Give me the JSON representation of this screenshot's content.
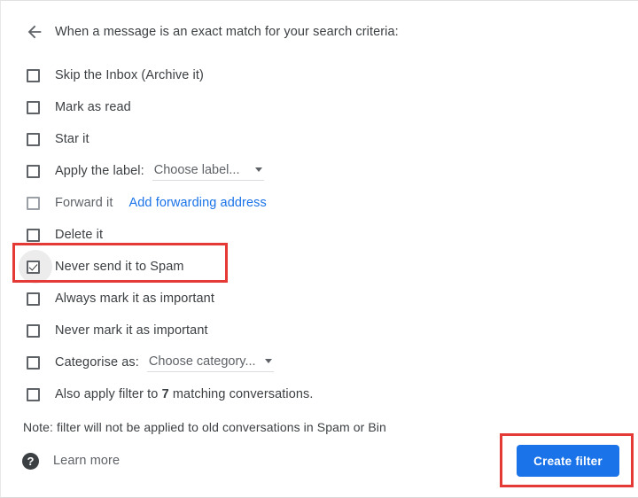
{
  "header": {
    "back_icon": "arrow-left-icon",
    "title": "When a message is an exact match for your search criteria:"
  },
  "options": [
    {
      "label": "Skip the Inbox (Archive it)",
      "checked": false,
      "disabled": false
    },
    {
      "label": "Mark as read",
      "checked": false,
      "disabled": false
    },
    {
      "label": "Star it",
      "checked": false,
      "disabled": false
    },
    {
      "label": "Apply the label:",
      "checked": false,
      "disabled": false,
      "dropdown": "Choose label..."
    },
    {
      "label": "Forward it",
      "checked": false,
      "disabled": true,
      "link": "Add forwarding address"
    },
    {
      "label": "Delete it",
      "checked": false,
      "disabled": false
    },
    {
      "label": "Never send it to Spam",
      "checked": true,
      "disabled": false,
      "highlighted": true
    },
    {
      "label": "Always mark it as important",
      "checked": false,
      "disabled": false
    },
    {
      "label": "Never mark it as important",
      "checked": false,
      "disabled": false
    },
    {
      "label": "Categorise as:",
      "checked": false,
      "disabled": false,
      "dropdown": "Choose category..."
    },
    {
      "label_pre": "Also apply filter to ",
      "label_count": "7",
      "label_post": " matching conversations.",
      "checked": false,
      "disabled": false
    }
  ],
  "note": "Note: filter will not be applied to old conversations in Spam or Bin",
  "learn_more": {
    "icon": "help-icon",
    "glyph": "?",
    "label": "Learn more"
  },
  "create_button": {
    "label": "Create filter",
    "color": "#1a73e8"
  },
  "annotations": {
    "color": "#e53935",
    "spam_box_target": "Never send it to Spam",
    "button_box_target": "Create filter"
  },
  "colors": {
    "accent_blue": "#1a73e8",
    "text_primary": "#3c4043",
    "text_secondary": "#5f6368",
    "annotation_red": "#e53935",
    "background": "#ffffff"
  }
}
